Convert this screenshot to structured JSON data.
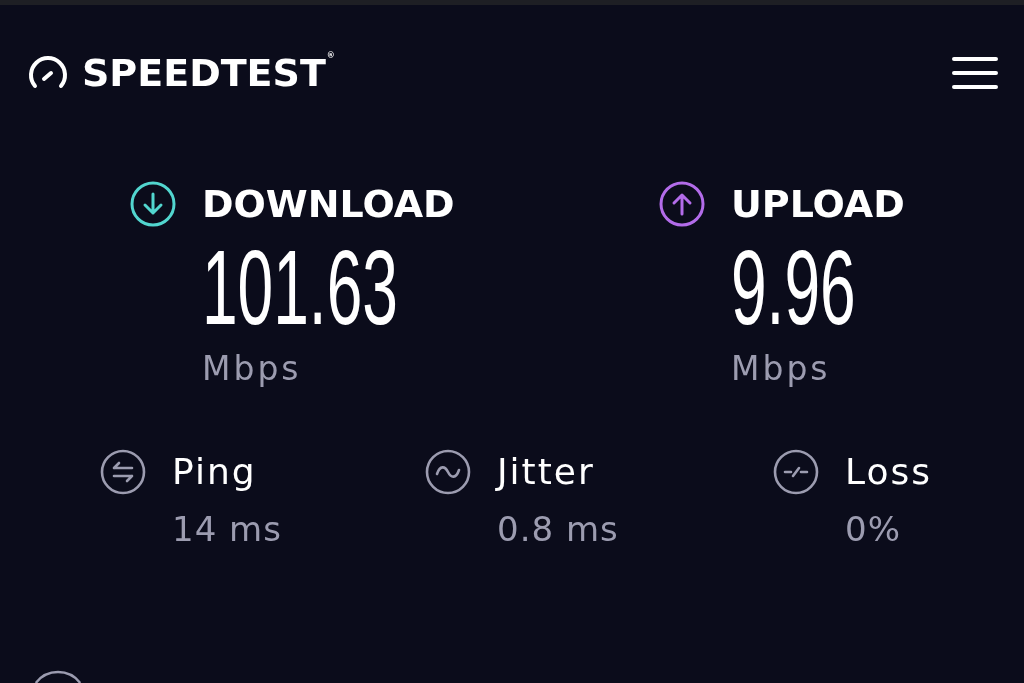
{
  "header": {
    "logo": "SPEEDTEST$^{®}$"
  },
  "results": [
    {
      "kind": "download",
      "label": "DOWNLOAD",
      "value": "101.63",
      "unit": "Mbps",
      "color": "#52d6cf"
    },
    {
      "kind": "upload",
      "label": "UPLOAD",
      "value": "9.96",
      "unit": "Mbps",
      "color": "#b36cea"
    }
  ],
  "metrics": [
    {
      "kind": "ping",
      "label": "Ping",
      "value": "14 ms"
    },
    {
      "kind": "jitter",
      "label": "Jitter",
      "value": "0.8 ms"
    },
    {
      "kind": "loss",
      "label": "Loss",
      "value": "0%"
    }
  ]
}
